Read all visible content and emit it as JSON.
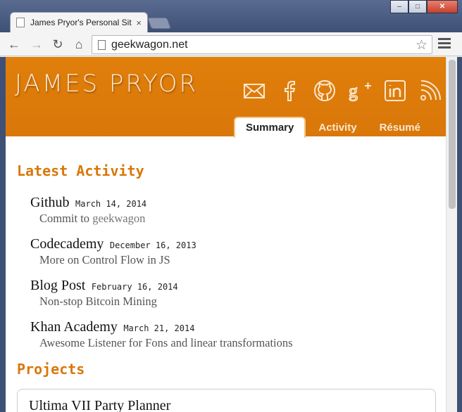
{
  "browser": {
    "tab_title": "James Pryor's Personal Site",
    "tab_close": "×",
    "url": "geekwagon.net",
    "nav": {
      "back": "←",
      "forward": "→",
      "reload": "↻",
      "home": "⌂"
    },
    "star": "☆",
    "window": {
      "minimize": "–",
      "maximize": "□",
      "close": "✕"
    }
  },
  "site": {
    "title": "JAMES PRYOR",
    "social_icons": [
      "mail-icon",
      "facebook-icon",
      "github-icon",
      "google-plus-icon",
      "linkedin-icon",
      "rss-icon"
    ],
    "tabs": [
      {
        "label": "Summary",
        "active": true
      },
      {
        "label": "Activity",
        "active": false
      },
      {
        "label": "Résumé",
        "active": false
      }
    ],
    "accent_color": "#d9770a"
  },
  "latest": {
    "heading": "Latest Activity",
    "items": [
      {
        "title": "Github",
        "date": "March 14, 2014",
        "desc_prefix": "Commit to ",
        "desc_link": "geekwagon"
      },
      {
        "title": "Codecademy",
        "date": "December 16, 2013",
        "desc_prefix": "More on Control Flow in JS",
        "desc_link": ""
      },
      {
        "title": "Blog Post",
        "date": "February 16, 2014",
        "desc_prefix": "Non-stop Bitcoin Mining",
        "desc_link": ""
      },
      {
        "title": "Khan Academy",
        "date": "March 21, 2014",
        "desc_prefix": "Awesome Listener for Fons and linear transformations",
        "desc_link": ""
      }
    ]
  },
  "projects": {
    "heading": "Projects",
    "items": [
      {
        "title": "Ultima VII Party Planner"
      }
    ]
  }
}
